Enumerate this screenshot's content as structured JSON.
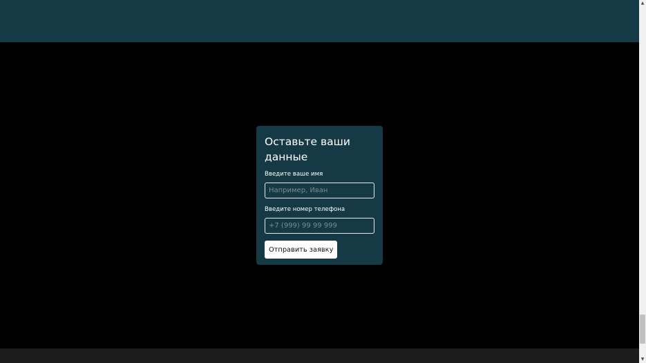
{
  "modal": {
    "title": "Оставьте ваши данные",
    "name_field": {
      "label": "Введите ваше имя",
      "placeholder": "Например, Иван",
      "value": ""
    },
    "phone_field": {
      "label": "Введите номер телефона",
      "placeholder": "+7 (999) 99 99 999",
      "value": ""
    },
    "submit_label": "Отправить заявку"
  },
  "scrollbar": {
    "up_icon": "chevron-up-icon",
    "down_icon": "chevron-down-icon",
    "up_glyph": "▲",
    "down_glyph": "▼"
  },
  "colors": {
    "modal_background": "#153a45",
    "top_band": "#153a45",
    "overlay": "#000000",
    "bottom_band": "#1c1c1c",
    "button_background": "#ffffff"
  }
}
